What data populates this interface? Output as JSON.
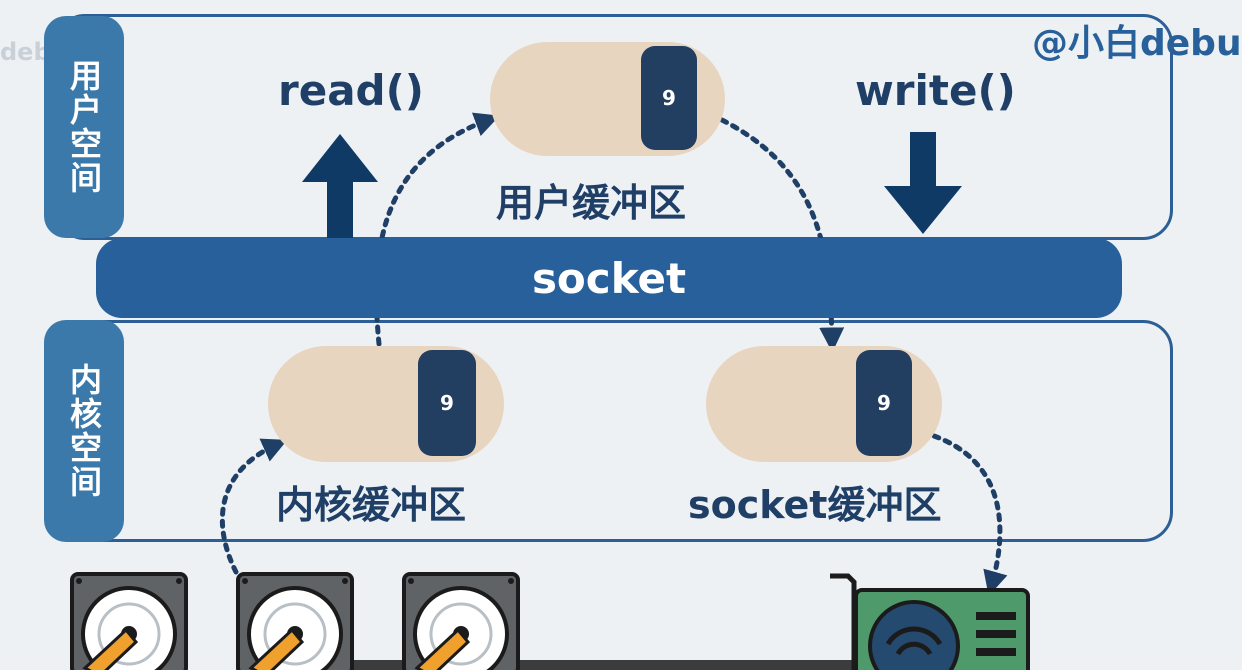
{
  "watermark": {
    "left": "debug",
    "right": "@小白debu"
  },
  "user_space": {
    "label": "用户空间"
  },
  "kernel_space": {
    "label": "内核空间"
  },
  "operations": {
    "read": "read()",
    "write": "write()"
  },
  "socket_bar": {
    "label": "socket"
  },
  "buffers": {
    "user": {
      "label": "用户缓冲区",
      "value": "9"
    },
    "kernel": {
      "label": "内核缓冲区",
      "value": "9"
    },
    "socket": {
      "label": "socket缓冲区",
      "value": "9"
    }
  },
  "colors": {
    "frame": "#2b5f95",
    "socket_bar": "#27609a",
    "side_label": "#3b79aa",
    "buffer_fill": "#e8d5bf",
    "badge": "#223e60",
    "arrow": "#0f3a66",
    "text": "#1f3f66"
  },
  "devices": {
    "disks": [
      "hard-disk-icon",
      "hard-disk-icon",
      "hard-disk-icon"
    ],
    "network": "network-card-icon"
  }
}
